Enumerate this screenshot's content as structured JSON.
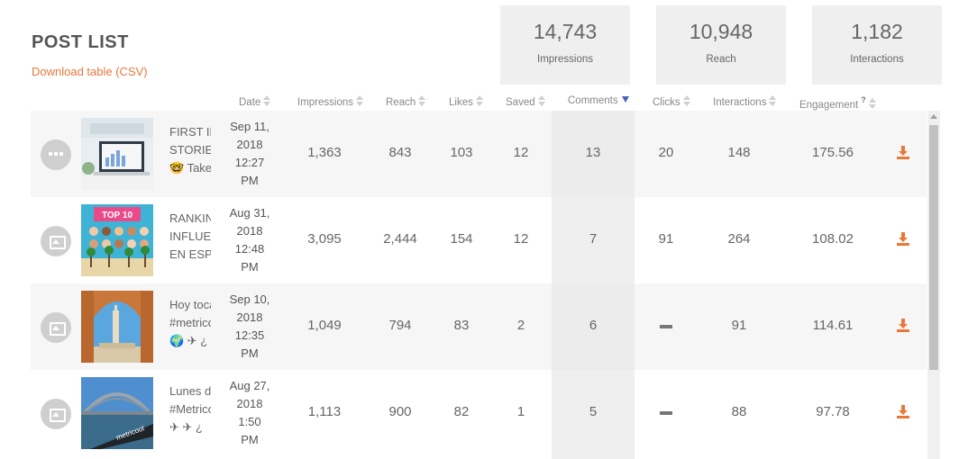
{
  "header": {
    "title": "POST LIST",
    "download_link": "Download table (CSV)"
  },
  "stats": [
    {
      "value": "14,743",
      "label": "Impressions"
    },
    {
      "value": "10,948",
      "label": "Reach"
    },
    {
      "value": "1,182",
      "label": "Interactions"
    }
  ],
  "columns": {
    "date": "Date",
    "impressions": "Impressions",
    "reach": "Reach",
    "likes": "Likes",
    "saved": "Saved",
    "comments": "Comments",
    "clicks": "Clicks",
    "interactions": "Interactions",
    "engagement": "Engagement",
    "help_mark": "?"
  },
  "sort": {
    "column": "comments",
    "direction": "descending"
  },
  "accent_color": "#e8773a",
  "rows": [
    {
      "type_icon": "more-dots-icon",
      "caption": [
        "FIRST INSTAGRAM",
        "STORIES",
        "🤓 Take"
      ],
      "date": [
        "Sep 11,",
        "2018",
        "12:27",
        "PM"
      ],
      "impressions": "1,363",
      "reach": "843",
      "likes": "103",
      "saved": "12",
      "comments": "13",
      "clicks": "20",
      "interactions": "148",
      "engagement": "175.56"
    },
    {
      "type_icon": "image-icon",
      "caption": [
        "RANKING",
        "INFLUENCERS",
        "EN ESPAÑA"
      ],
      "thumb_text": [
        "TOP 10"
      ],
      "date": [
        "Aug 31,",
        "2018",
        "12:48",
        "PM"
      ],
      "impressions": "3,095",
      "reach": "2,444",
      "likes": "154",
      "saved": "12",
      "comments": "7",
      "clicks": "91",
      "interactions": "264",
      "engagement": "108.02"
    },
    {
      "type_icon": "image-icon",
      "caption": [
        "Hoy toca",
        "#metricool",
        "🌍 ✈ ¿"
      ],
      "date": [
        "Sep 10,",
        "2018",
        "12:35",
        "PM"
      ],
      "impressions": "1,049",
      "reach": "794",
      "likes": "83",
      "saved": "2",
      "comments": "6",
      "clicks": "—",
      "interactions": "91",
      "engagement": "114.61"
    },
    {
      "type_icon": "image-icon",
      "caption": [
        "Lunes de",
        "#Metricool",
        "✈ ✈ ¿"
      ],
      "date": [
        "Aug 27,",
        "2018",
        "1:50",
        "PM"
      ],
      "impressions": "1,113",
      "reach": "900",
      "likes": "82",
      "saved": "1",
      "comments": "5",
      "clicks": "—",
      "interactions": "88",
      "engagement": "97.78"
    }
  ]
}
